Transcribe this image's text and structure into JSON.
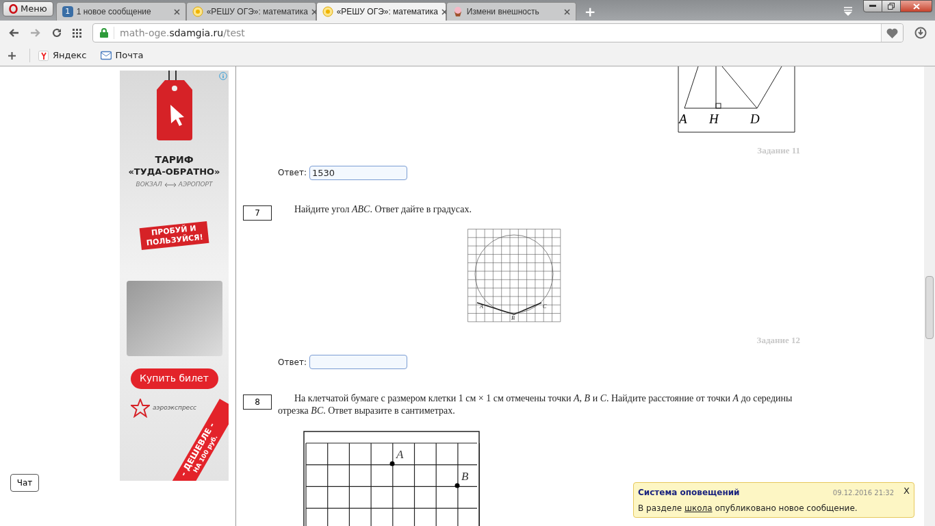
{
  "browser": {
    "menu_label": "Меню",
    "tabs": [
      {
        "kind": "badge",
        "badge": "1",
        "title": "1 новое сообщение",
        "selected": false
      },
      {
        "kind": "sun",
        "title": "«РЕШУ ОГЭ»: математика",
        "selected": false
      },
      {
        "kind": "sun",
        "title": "«РЕШУ ОГЭ»: математика",
        "selected": true
      },
      {
        "kind": "cake",
        "title": "Измени внешность",
        "selected": false
      }
    ],
    "new_tab": "+",
    "url": {
      "prefix": "math-oge.",
      "domain": "sdamgia.ru",
      "path": "/test"
    },
    "bookmarks": [
      {
        "kind": "yandex",
        "label": "Яндекс"
      },
      {
        "kind": "mail",
        "label": "Почта"
      }
    ]
  },
  "sidebar": {
    "chat_button": "Чат",
    "ad": {
      "title": "ТАРИФ",
      "subtitle": "«ТУДА-ОБРАТНО»",
      "from": "ВОКЗАЛ",
      "to": "АЭРОПОРТ",
      "badge_line_1": "ПРОБУЙ И",
      "badge_line_2": "ПОЛЬЗУЙСЯ!",
      "button": "Купить билет",
      "brand": "аэроэкспресс",
      "ribbon_1": "- ДЕШЕВЛЕ -",
      "ribbon_2": "НА 100 руб."
    }
  },
  "content": {
    "top_figure": {
      "labels": [
        "A",
        "H",
        "D"
      ]
    },
    "tasks": [
      {
        "source": "Задание 11",
        "answer_label": "Ответ:",
        "answer": "1530"
      },
      {
        "number": "7",
        "text": "Найдите угол *ABC*. Ответ дайте в градусах.",
        "figure": {
          "kind": "circle",
          "labels": [
            "A",
            "B",
            "C"
          ]
        },
        "source": "Задание 12",
        "answer_label": "Ответ:"
      },
      {
        "number": "8",
        "text": "На клетчатой бумаге с размером клетки 1 см × 1 см отмечены точки *A*, *B* и *C*. Найдите расстояние от точки *A* до середины отрезка *BC*. Ответ выразите в сантиметрах.",
        "figure": {
          "kind": "points",
          "labels": [
            "A",
            "B"
          ]
        }
      }
    ]
  },
  "notification": {
    "title": "Система оповещений",
    "time": "09.12.2016 21:32",
    "close": "X",
    "text_before": "В разделе",
    "link": "школа",
    "text_after": "опубликовано новое сообщение."
  }
}
